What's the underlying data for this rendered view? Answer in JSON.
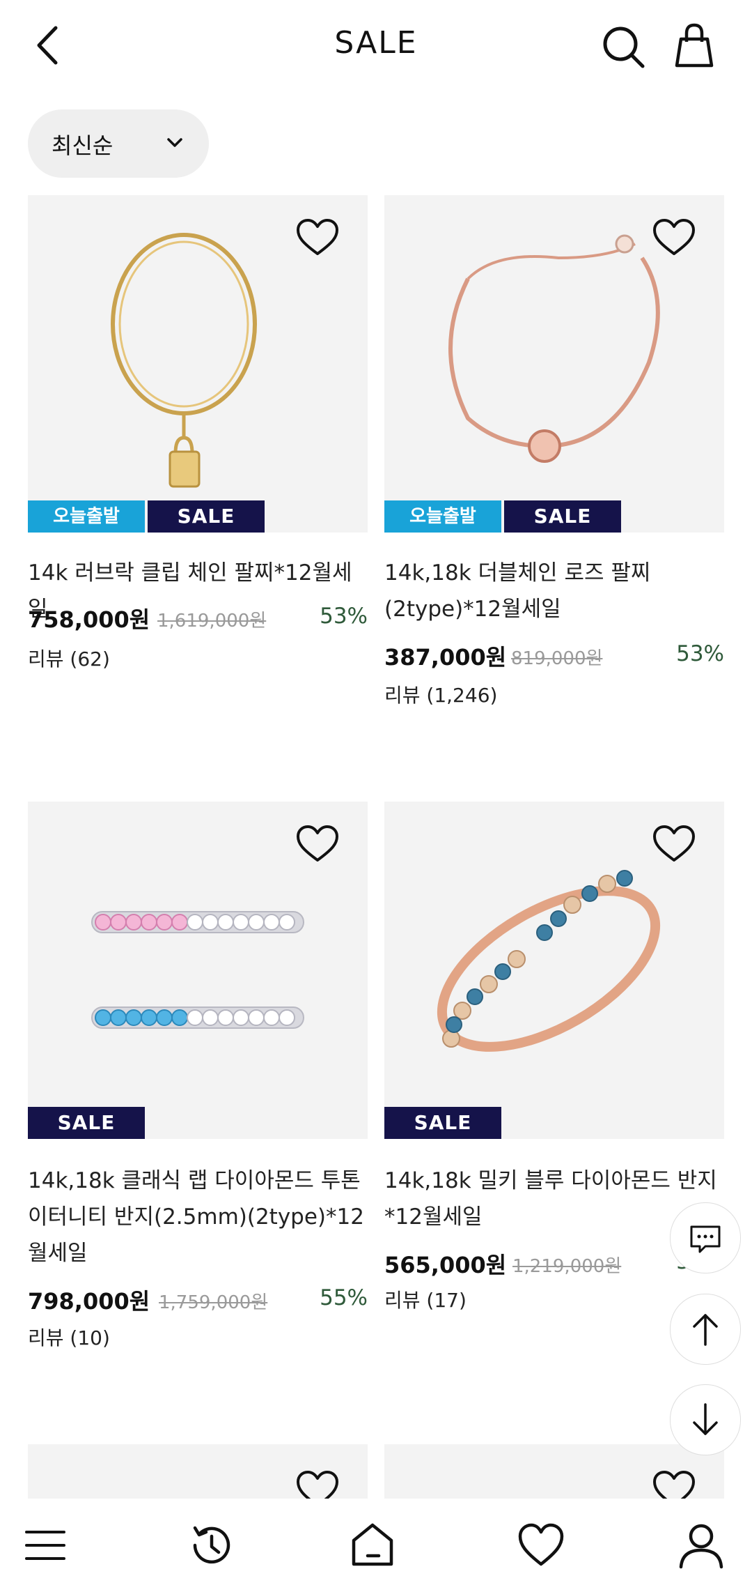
{
  "header": {
    "title": "SALE"
  },
  "sort": {
    "label": "최신순"
  },
  "products": [
    {
      "name": "14k 러브락 클립 체인 팔찌*12월세일",
      "price": "758,000원",
      "original_price": "1,619,000원",
      "discount": "53%",
      "review": "리뷰 (62)",
      "badges": [
        "오늘출발",
        "SALE"
      ]
    },
    {
      "name": "14k,18k 더블체인 로즈 팔찌(2type)*12월세일",
      "price": "387,000원",
      "original_price": "819,000원",
      "discount": "53%",
      "review": "리뷰 (1,246)",
      "badges": [
        "오늘출발",
        "SALE"
      ]
    },
    {
      "name": "14k,18k 클래식 랩 다이아몬드 투톤 이터니티 반지(2.5mm)(2type)*12월세일",
      "price": "798,000원",
      "original_price": "1,759,000원",
      "discount": "55%",
      "review": "리뷰 (10)",
      "badges": [
        "SALE"
      ]
    },
    {
      "name": "14k,18k 밀키 블루 다이아몬드 반지*12월세일",
      "price": "565,000원",
      "original_price": "1,219,000원",
      "discount": "54%",
      "review": "리뷰 (17)",
      "badges": [
        "SALE"
      ]
    }
  ],
  "colors": {
    "today_badge": "#19a3d8",
    "sale_badge": "#15134a",
    "discount": "#2f5a3a",
    "image_bg": "#f3f3f3"
  }
}
